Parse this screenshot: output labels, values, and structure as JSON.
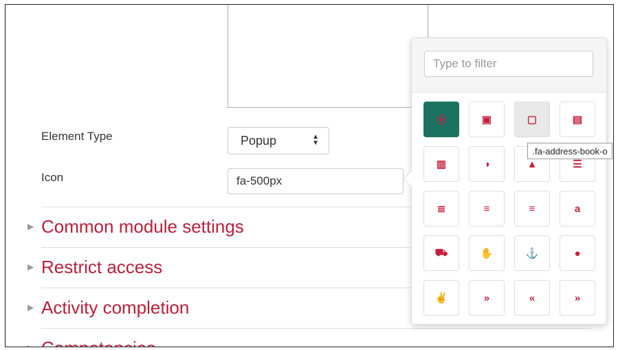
{
  "form": {
    "element_type_label": "Element Type",
    "element_type_value": "Popup",
    "icon_label": "Icon",
    "icon_value": "fa-500px"
  },
  "sections": [
    {
      "title": "Common module settings"
    },
    {
      "title": "Restrict access"
    },
    {
      "title": "Activity completion"
    },
    {
      "title": "Competencies"
    }
  ],
  "icon_picker": {
    "filter_placeholder": "Type to filter",
    "tooltip": ".fa-address-book-o",
    "icons": [
      {
        "name": "fa-500px",
        "glyph": "⦿"
      },
      {
        "name": "fa-address-book",
        "glyph": "▣"
      },
      {
        "name": "fa-address-book-o",
        "glyph": "▢"
      },
      {
        "name": "fa-address-card",
        "glyph": "▤"
      },
      {
        "name": "fa-address-card-o",
        "glyph": "▥"
      },
      {
        "name": "fa-adjust",
        "glyph": "◑"
      },
      {
        "name": "fa-adn",
        "glyph": "▲"
      },
      {
        "name": "fa-align-center",
        "glyph": "☰"
      },
      {
        "name": "fa-align-justify",
        "glyph": "≣"
      },
      {
        "name": "fa-align-left",
        "glyph": "≡"
      },
      {
        "name": "fa-align-right",
        "glyph": "≡"
      },
      {
        "name": "fa-amazon",
        "glyph": "a"
      },
      {
        "name": "fa-ambulance",
        "glyph": "⛟"
      },
      {
        "name": "fa-american-sign-language-interpreting",
        "glyph": "✋"
      },
      {
        "name": "fa-anchor",
        "glyph": "⚓"
      },
      {
        "name": "fa-android",
        "glyph": "●"
      },
      {
        "name": "fa-angellist",
        "glyph": "✌"
      },
      {
        "name": "fa-angle-double-down",
        "glyph": "»"
      },
      {
        "name": "fa-angle-double-left",
        "glyph": "«"
      },
      {
        "name": "fa-angle-double-right",
        "glyph": "»"
      }
    ],
    "selected_index": 0,
    "hover_index": 2
  },
  "colors": {
    "accent": "#b8203a",
    "selected": "#1a7360"
  }
}
